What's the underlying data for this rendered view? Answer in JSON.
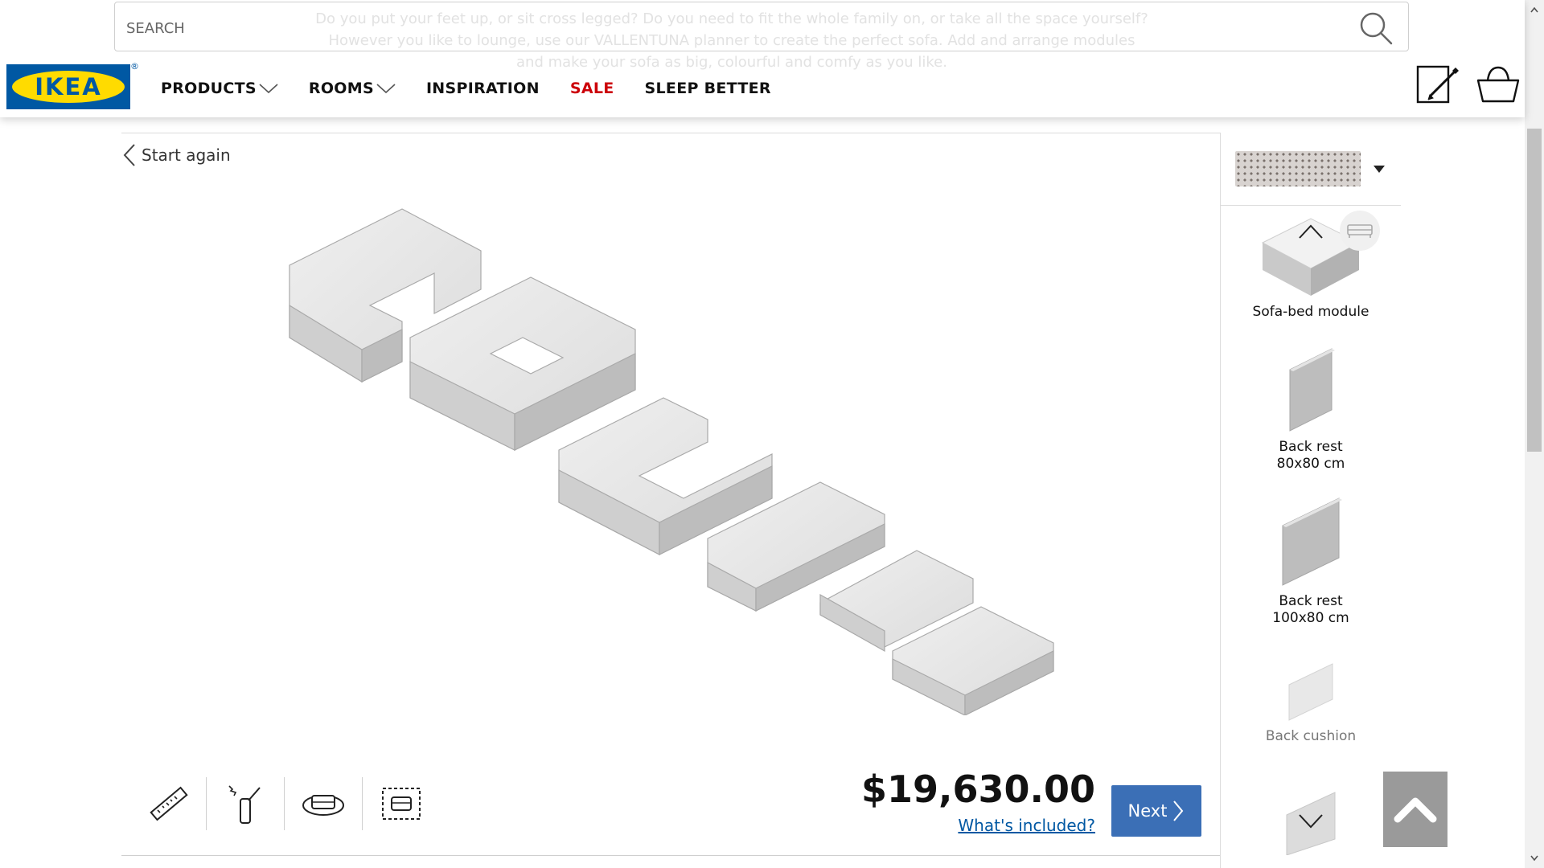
{
  "header": {
    "search_placeholder": "SEARCH",
    "ghost_text": [
      "Do you put your feet up, or sit cross legged? Do you need to fit the whole family on, or take all the space yourself?",
      "However you like to lounge, use our VALLENTUNA planner to create the perfect sofa. Add and arrange modules",
      "and make your sofa as big, colourful and comfy as you like."
    ],
    "logo_text": "IKEA",
    "logo_reg": "®",
    "nav": [
      {
        "label": "PRODUCTS"
      },
      {
        "label": "ROOMS"
      },
      {
        "label": "INSPIRATION"
      },
      {
        "label": "SALE"
      },
      {
        "label": "SLEEP BETTER"
      }
    ],
    "icons": {
      "search": "search-icon",
      "edit": "edit-list-icon",
      "basket": "shopping-basket-icon"
    }
  },
  "planner": {
    "start_again": "Start again",
    "tools": [
      "ruler-icon",
      "stick-icon",
      "rotate-sofa-icon",
      "select-area-icon"
    ],
    "price": "$19,630.00",
    "whats_included": "What's included?",
    "next_label": "Next"
  },
  "panel": {
    "fabric": "fabric-swatch",
    "modules": [
      {
        "line1": "Sofa-bed module",
        "line2": "",
        "dim": false
      },
      {
        "line1": "Back rest",
        "line2": "80x80 cm",
        "dim": false
      },
      {
        "line1": "Back rest",
        "line2": "100x80 cm",
        "dim": false
      },
      {
        "line1": "Back cushion",
        "line2": "",
        "dim": true
      }
    ]
  },
  "colors": {
    "brand_blue": "#0058a3",
    "brand_yellow": "#ffdb00",
    "sale_red": "#cc0008",
    "button_blue": "#3b6fb6"
  }
}
